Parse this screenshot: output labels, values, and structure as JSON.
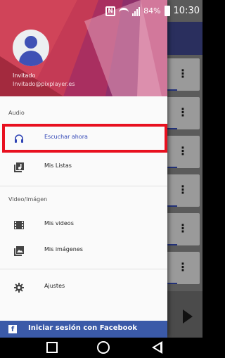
{
  "status_bar": {
    "battery": "84%",
    "time": "10:30",
    "icons": [
      "nfc-icon",
      "wifi-icon",
      "signal-icon",
      "battery-icon"
    ]
  },
  "drawer": {
    "user": {
      "name": "Invitado",
      "email": "Invitado@pixplayer.es"
    },
    "sections": [
      {
        "label": "Audio",
        "items": [
          {
            "label": "Escuchar ahora",
            "icon": "headphones-icon",
            "active": true
          },
          {
            "label": "Mis Listas",
            "icon": "playlist-icon",
            "active": false
          }
        ]
      },
      {
        "label": "Video/Imágen",
        "items": [
          {
            "label": "Mis videos",
            "icon": "film-icon",
            "active": false
          },
          {
            "label": "Mis imágenes",
            "icon": "image-icon",
            "active": false
          }
        ]
      },
      {
        "label": "",
        "items": [
          {
            "label": "Ajustes",
            "icon": "gear-icon",
            "active": false
          }
        ]
      }
    ],
    "facebook_button": {
      "label": "Iniciar sesión con Facebook",
      "icon": "facebook-icon"
    }
  },
  "colors": {
    "accent": "#2f44b5",
    "highlight": "#e8101f",
    "toolbar": "#2a2f5e",
    "facebook": "#3b5aa8"
  },
  "navigation_bar": {
    "icons": [
      "recent-apps-icon",
      "home-icon",
      "back-icon"
    ]
  }
}
